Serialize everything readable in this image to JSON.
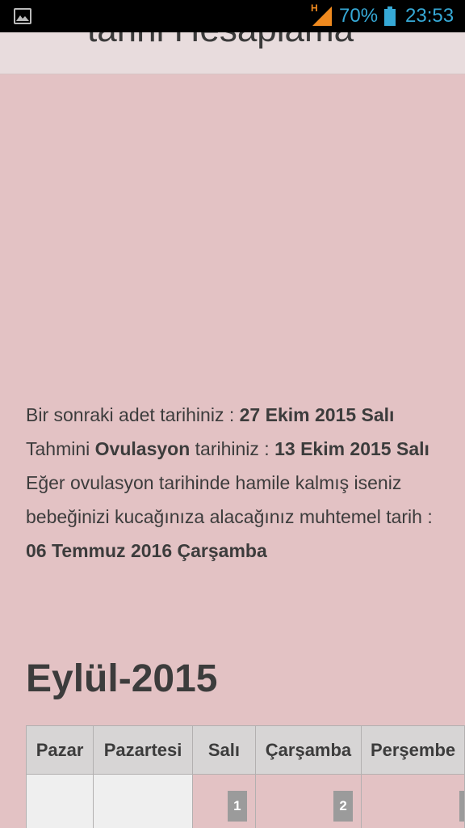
{
  "status_bar": {
    "battery_percent": "70%",
    "time": "23:53",
    "network_type": "H"
  },
  "header": {
    "title": "tarihi Hesaplama"
  },
  "info": {
    "next_period_label": "Bir sonraki adet tarihiniz : ",
    "next_period_value": "27 Ekim 2015 Salı",
    "ovulation_label_prefix": "Tahmini ",
    "ovulation_label_bold": "Ovulasyon",
    "ovulation_label_suffix": " tarihiniz : ",
    "ovulation_value": "13 Ekim 2015 Salı",
    "due_text": "Eğer ovulasyon tarihinde hamile kalmış iseniz bebeğinizi kucağınıza alacağınız muhtemel tarih : ",
    "due_value": "06 Temmuz 2016 Çarşamba"
  },
  "calendar": {
    "month_title": "Eylül-2015",
    "headers": [
      "Pazar",
      "Pazartesi",
      "Salı",
      "Çarşamba",
      "Perşembe"
    ],
    "first_row": [
      "",
      "",
      "1",
      "2",
      ""
    ]
  }
}
